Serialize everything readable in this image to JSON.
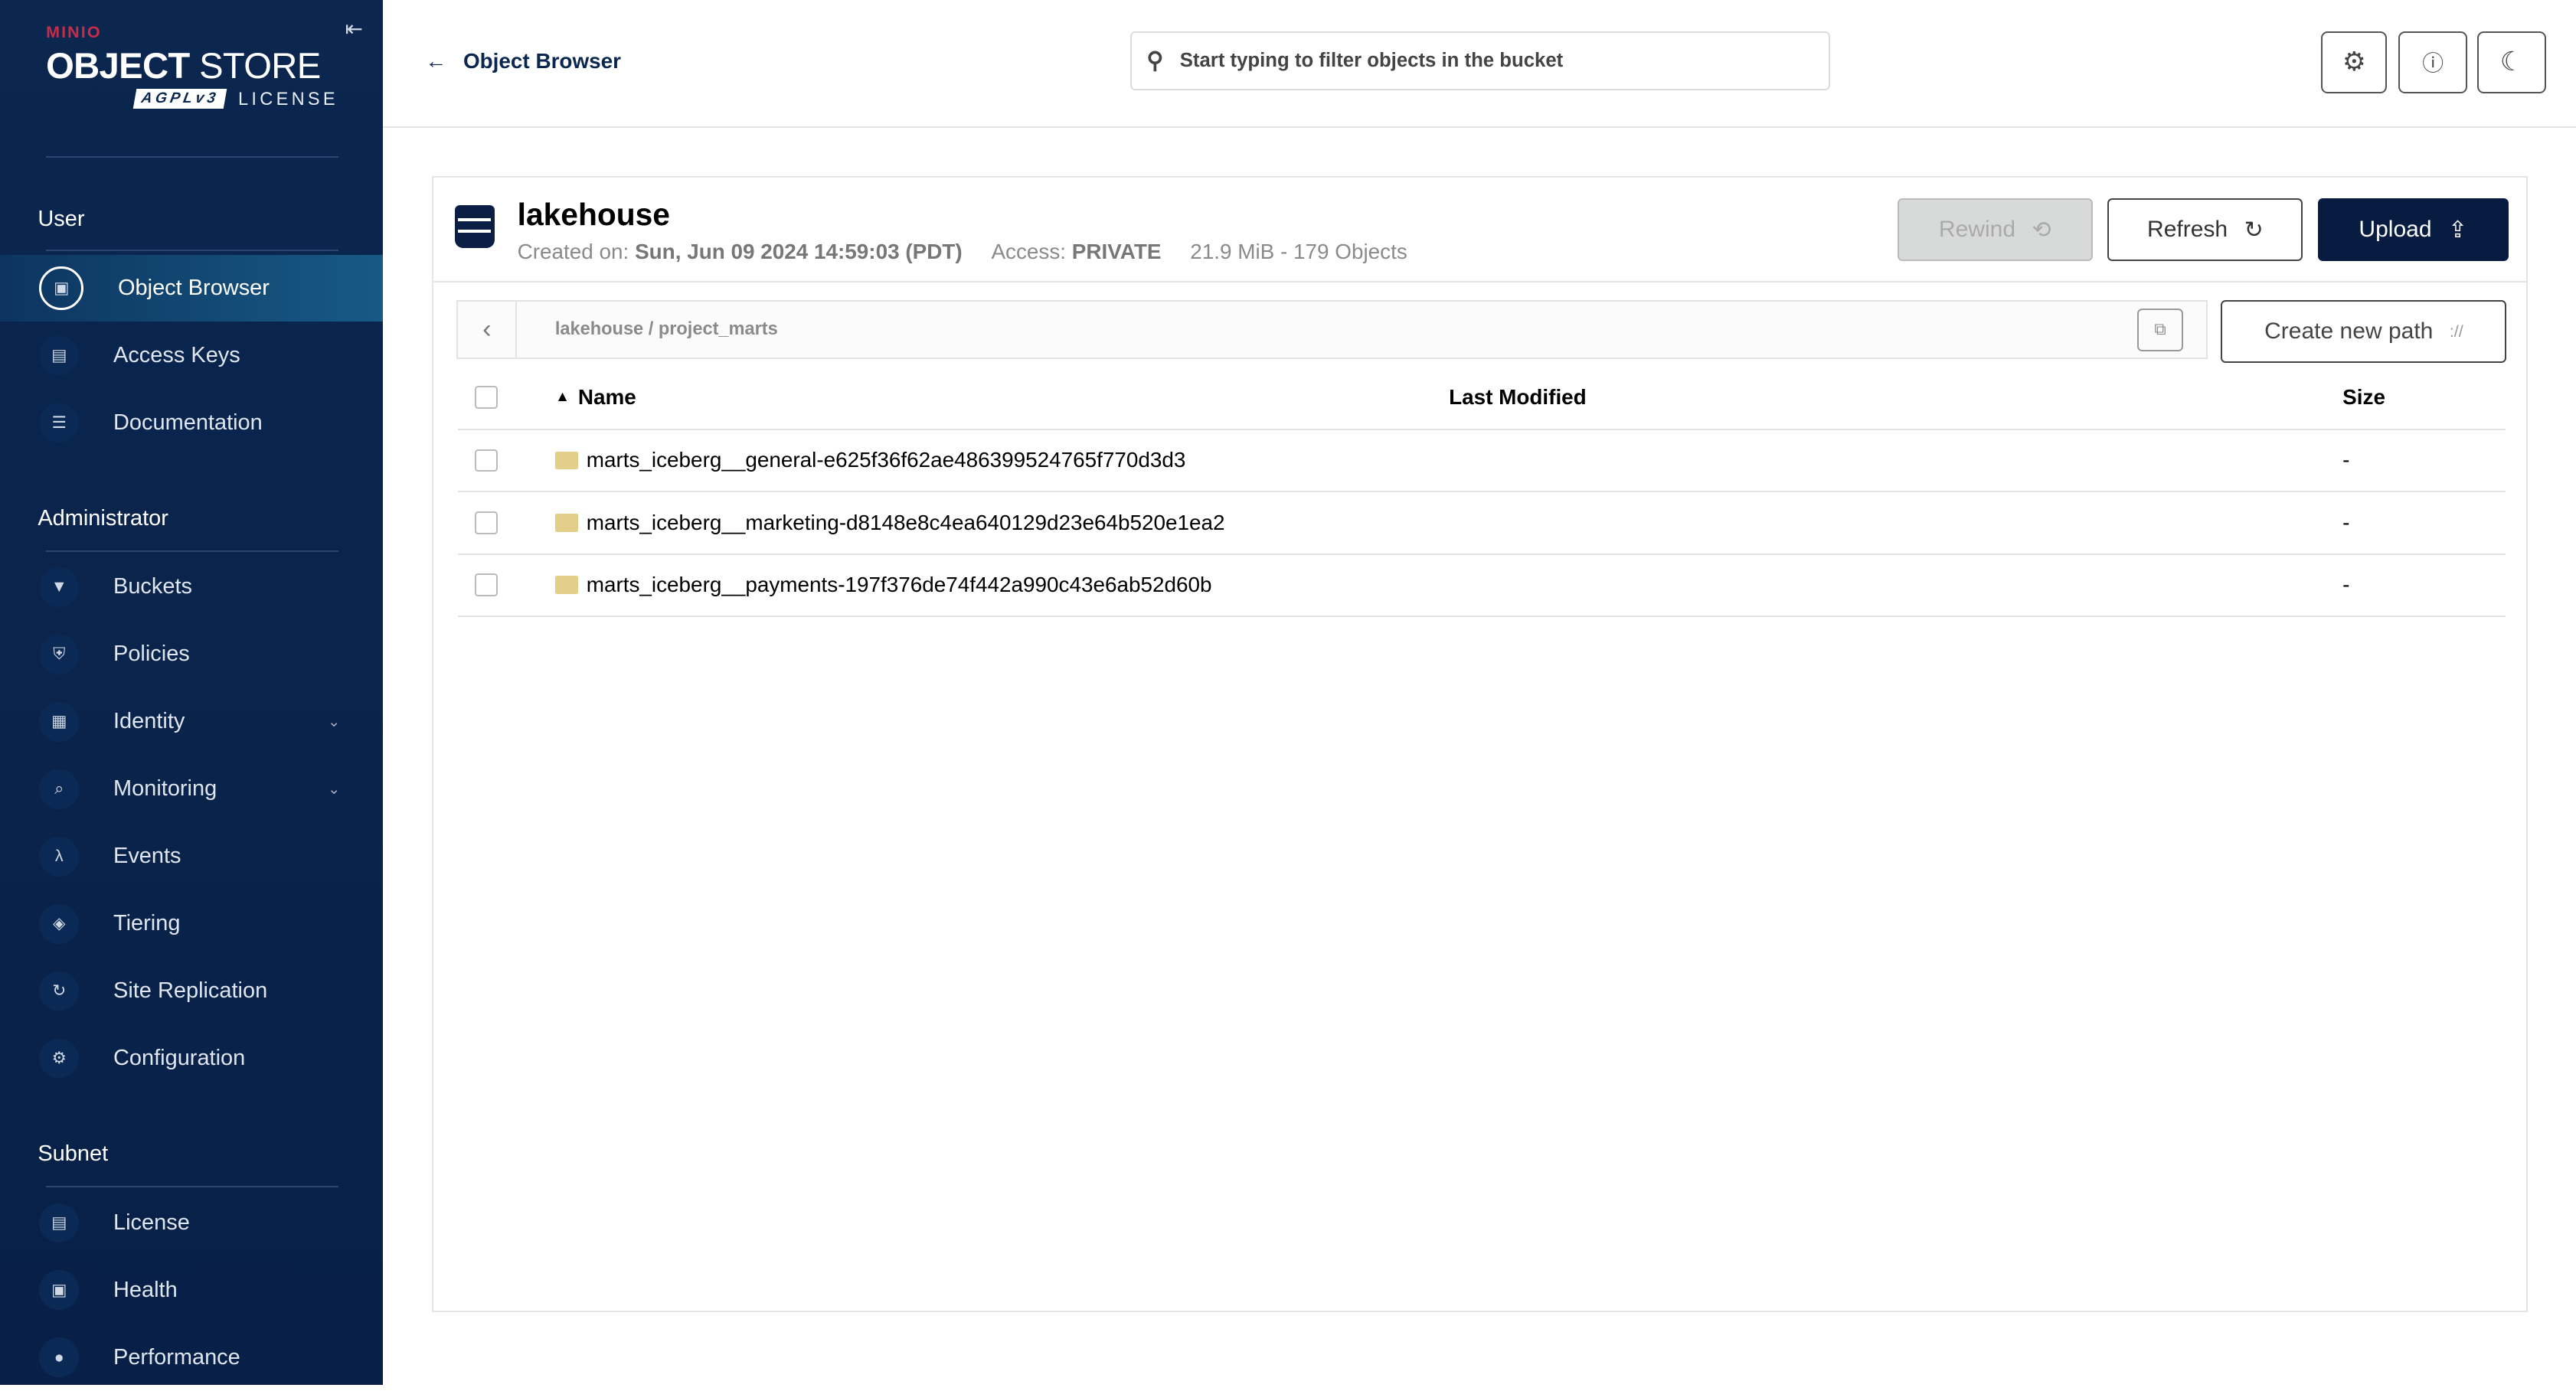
{
  "sidebar": {
    "logo": {
      "brand": "MINIO",
      "product_bold": "OBJECT",
      "product_light": "STORE",
      "badge": "AGPLv3",
      "license": "LICENSE"
    },
    "sections": [
      {
        "title": "User",
        "items": [
          {
            "label": "Object Browser",
            "icon": "object-browser-icon",
            "active": true
          },
          {
            "label": "Access Keys",
            "icon": "access-keys-icon"
          },
          {
            "label": "Documentation",
            "icon": "documentation-icon"
          }
        ]
      },
      {
        "title": "Administrator",
        "items": [
          {
            "label": "Buckets",
            "icon": "bucket-icon"
          },
          {
            "label": "Policies",
            "icon": "shield-icon"
          },
          {
            "label": "Identity",
            "icon": "identity-icon",
            "expandable": true
          },
          {
            "label": "Monitoring",
            "icon": "monitoring-icon",
            "expandable": true
          },
          {
            "label": "Events",
            "icon": "lambda-icon"
          },
          {
            "label": "Tiering",
            "icon": "tiering-icon"
          },
          {
            "label": "Site Replication",
            "icon": "replication-icon"
          },
          {
            "label": "Configuration",
            "icon": "gear-icon"
          }
        ]
      },
      {
        "title": "Subnet",
        "items": [
          {
            "label": "License",
            "icon": "license-icon"
          },
          {
            "label": "Health",
            "icon": "health-icon"
          },
          {
            "label": "Performance",
            "icon": "performance-icon"
          }
        ]
      }
    ]
  },
  "topbar": {
    "back_label": "Object Browser",
    "search_placeholder": "Start typing to filter objects in the bucket"
  },
  "bucket": {
    "name": "lakehouse",
    "created_label": "Created on:",
    "created_value": "Sun, Jun 09 2024 14:59:03 (PDT)",
    "access_label": "Access:",
    "access_value": "PRIVATE",
    "usage": "21.9 MiB - 179 Objects"
  },
  "actions": {
    "rewind": "Rewind",
    "refresh": "Refresh",
    "upload": "Upload",
    "create_path": "Create new path"
  },
  "breadcrumb": "lakehouse / project_marts",
  "table": {
    "columns": {
      "name": "Name",
      "last_modified": "Last Modified",
      "size": "Size"
    },
    "rows": [
      {
        "name": "marts_iceberg__general-e625f36f62ae486399524765f770d3d3",
        "last_modified": "",
        "size": "-"
      },
      {
        "name": "marts_iceberg__marketing-d8148e8c4ea640129d23e64b520e1ea2",
        "last_modified": "",
        "size": "-"
      },
      {
        "name": "marts_iceberg__payments-197f376de74f442a990c43e6ab52d60b",
        "last_modified": "",
        "size": "-"
      }
    ]
  },
  "colors": {
    "sidebar": "#0b274f",
    "accent": "#081c42",
    "brand_red": "#c72c48",
    "folder": "#e4cf8a"
  }
}
